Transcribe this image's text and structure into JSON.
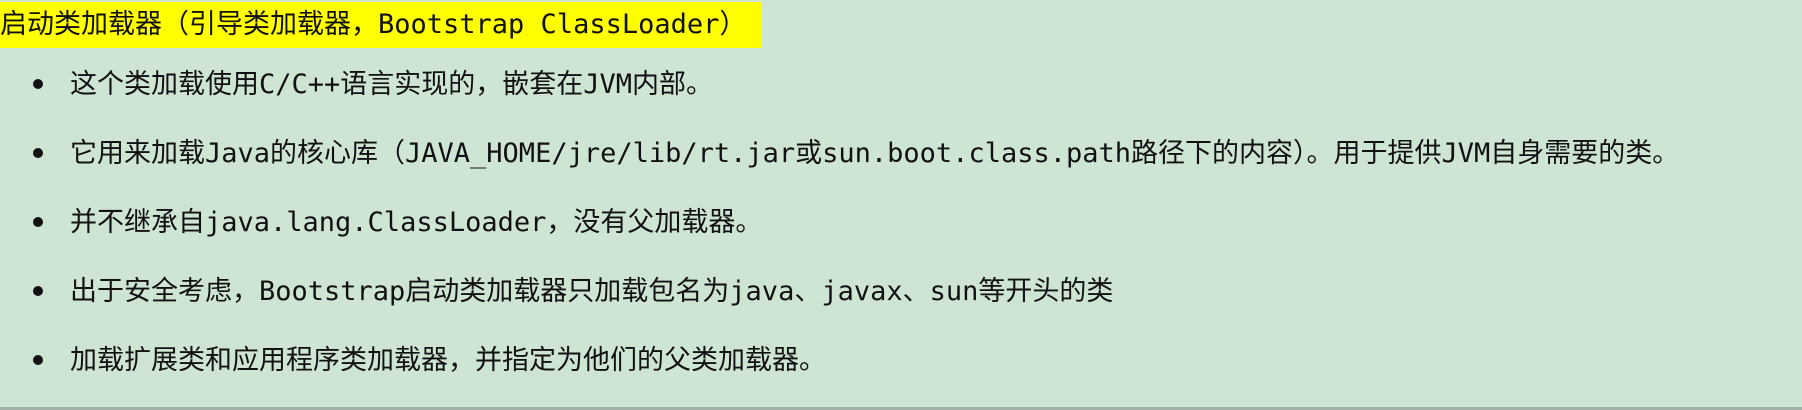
{
  "heading": "启动类加载器（引导类加载器，Bootstrap ClassLoader）",
  "bullets": [
    "这个类加载使用C/C++语言实现的，嵌套在JVM内部。",
    "它用来加载Java的核心库（JAVA_HOME/jre/lib/rt.jar或sun.boot.class.path路径下的内容）。用于提供JVM自身需要的类。",
    "并不继承自java.lang.ClassLoader，没有父加载器。",
    "出于安全考虑，Bootstrap启动类加载器只加载包名为java、javax、sun等开头的类",
    "加载扩展类和应用程序类加载器，并指定为他们的父类加载器。"
  ],
  "colors": {
    "background": "#cfe5d4",
    "highlight": "#ffff00",
    "text": "#111111"
  }
}
